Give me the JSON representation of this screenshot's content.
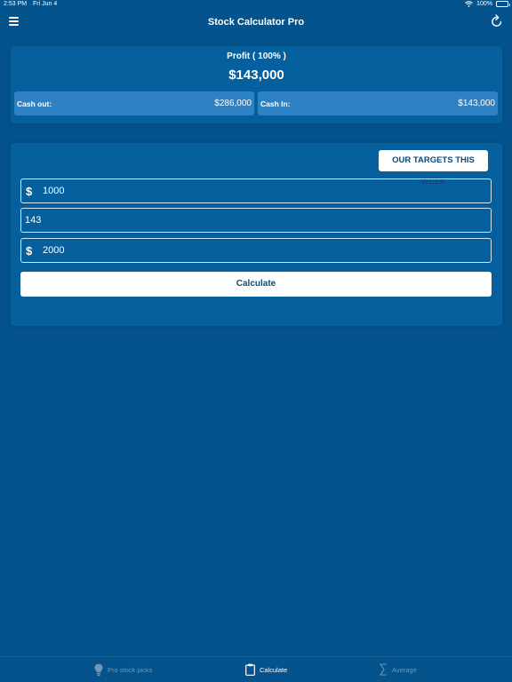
{
  "status_bar": {
    "time": "2:53 PM",
    "date": "Fri Jun 4",
    "battery": "100%",
    "wifi_icon": "wifi-icon",
    "battery_icon": "battery-icon"
  },
  "nav": {
    "title": "Stock Calculator Pro",
    "menu_icon": "hamburger-menu-icon",
    "refresh_icon": "refresh-icon"
  },
  "summary": {
    "profit_label": "Profit ( 100% )",
    "profit_value": "$143,000",
    "cash_out_label": "Cash out:",
    "cash_out_value": "$286,000",
    "cash_in_label": "Cash In:",
    "cash_in_value": "$143,000"
  },
  "calculator": {
    "targets_button": "OUR TARGETS THIS WEEK",
    "fields": [
      {
        "prefix": "$",
        "value": "1000"
      },
      {
        "prefix": "",
        "value": "143"
      },
      {
        "prefix": "$",
        "value": "2000"
      }
    ],
    "calculate_button": "Calculate"
  },
  "tabs": [
    {
      "label": "Pro stock picks",
      "icon": "lightbulb-icon",
      "active": false
    },
    {
      "label": "Calculate",
      "icon": "clipboard-icon",
      "active": true
    },
    {
      "label": "Average",
      "icon": "sigma-icon",
      "active": false
    }
  ],
  "colors": {
    "background": "#04538c",
    "card": "#07609e",
    "cash_box": "#2e82c4",
    "button_text": "#0a4a7c",
    "inactive_tab": "#6f97b8"
  }
}
